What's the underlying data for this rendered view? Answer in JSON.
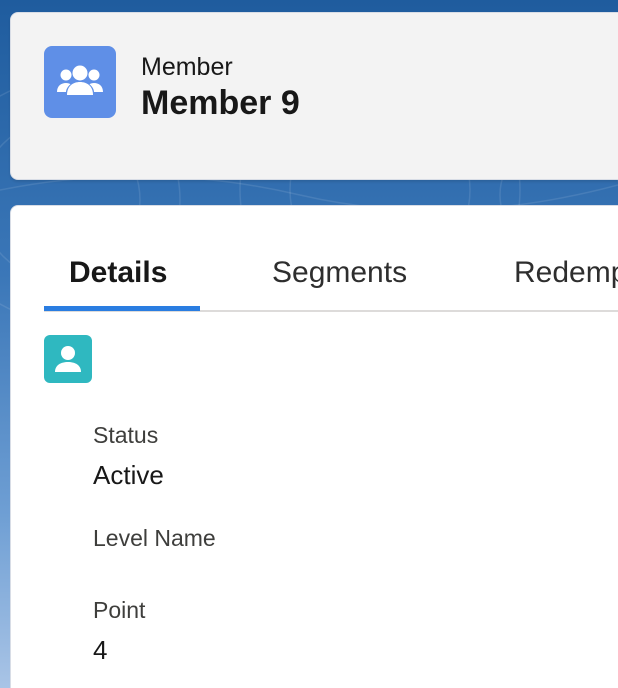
{
  "header": {
    "object_type": "Member",
    "record_name": "Member 9",
    "icon": "people-group-icon"
  },
  "tabs": [
    {
      "label": "Details",
      "active": true
    },
    {
      "label": "Segments",
      "active": false
    },
    {
      "label": "Redemp",
      "active": false
    }
  ],
  "record_icon": "person-icon",
  "fields": {
    "status": {
      "label": "Status",
      "value": "Active"
    },
    "level_name": {
      "label": "Level Name",
      "value": ""
    },
    "point": {
      "label": "Point",
      "value": "4"
    }
  },
  "colors": {
    "header_icon_bg": "#5f8fe7",
    "record_icon_bg": "#2fb8c0",
    "active_tab_underline": "#2a7de1"
  }
}
